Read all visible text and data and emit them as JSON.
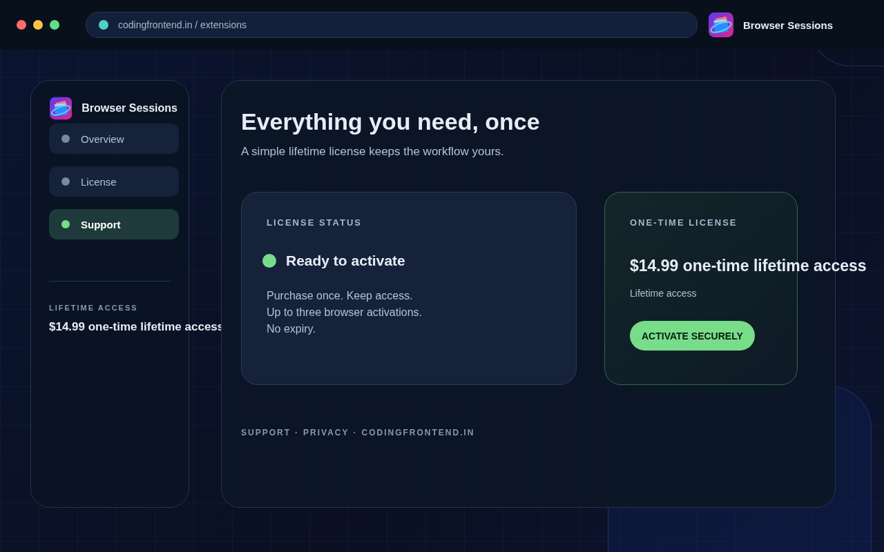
{
  "top_bar": {
    "address": "codingfrontend.in / extensions",
    "app_name": "Browser Sessions"
  },
  "sidebar": {
    "app_name": "Browser Sessions",
    "items": [
      {
        "label": "Overview",
        "selected": false
      },
      {
        "label": "License",
        "selected": false
      },
      {
        "label": "Support",
        "selected": true
      }
    ],
    "footer_label": "LIFETIME ACCESS",
    "footer_value": "$14.99 one-time lifetime access"
  },
  "main": {
    "title": "Everything you need, once",
    "subtitle": "A simple lifetime license keeps the workflow yours.",
    "status_card": {
      "label": "LICENSE STATUS",
      "status": "Ready to activate",
      "lines": [
        "Purchase once. Keep access.",
        "Up to three browser activations.",
        "No expiry."
      ]
    },
    "license_card": {
      "label": "ONE-TIME LICENSE",
      "price": "$14.99 one-time lifetime access",
      "note": "Lifetime access",
      "button": "ACTIVATE SECURELY"
    },
    "footer_links": [
      "SUPPORT",
      "PRIVACY",
      "CODINGFRONTEND.IN"
    ],
    "footer_separator": "·"
  }
}
